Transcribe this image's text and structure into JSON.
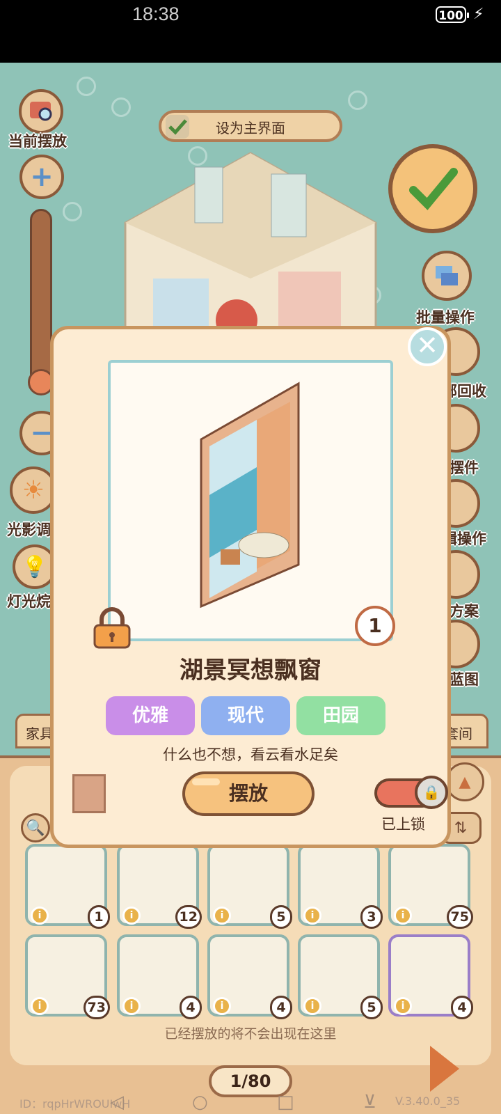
{
  "status_bar": {
    "time": "18:38",
    "battery": "100"
  },
  "scene": {
    "set_main_label": "设为主界面",
    "current_placement_label": "当前摆放",
    "left_labels": [
      "光影调",
      "灯光烷"
    ],
    "right_labels": [
      "批量操作",
      "部回收",
      "摆件",
      "辑操作",
      "方案",
      "蓝图",
      "套间"
    ],
    "confirm_icon": "check-icon"
  },
  "dialog": {
    "item_name": "湖景冥想飘窗",
    "tags": [
      {
        "label": "优雅",
        "color": "#c98ee8"
      },
      {
        "label": "现代",
        "color": "#8fb0f0"
      },
      {
        "label": "田园",
        "color": "#92e0a2"
      }
    ],
    "description": "什么也不想，看云看水足矣",
    "owned_count": "1",
    "place_button": "摆放",
    "lock_status": "已上锁"
  },
  "panel": {
    "tab_left": "家具",
    "tab_right": "套间",
    "items": [
      {
        "count": "1",
        "selected": false
      },
      {
        "count": "12",
        "selected": false
      },
      {
        "count": "5",
        "selected": false
      },
      {
        "count": "3",
        "selected": false
      },
      {
        "count": "75",
        "selected": false
      },
      {
        "count": "73",
        "selected": false
      },
      {
        "count": "4",
        "selected": false
      },
      {
        "count": "4",
        "selected": false
      },
      {
        "count": "5",
        "selected": false
      },
      {
        "count": "4",
        "selected": true
      }
    ],
    "hint": "已经摆放的将不会出现在这里",
    "page": "1/80",
    "player_id": "ID：rqpHrWROUIwH",
    "version": "V.3.40.0_35"
  }
}
